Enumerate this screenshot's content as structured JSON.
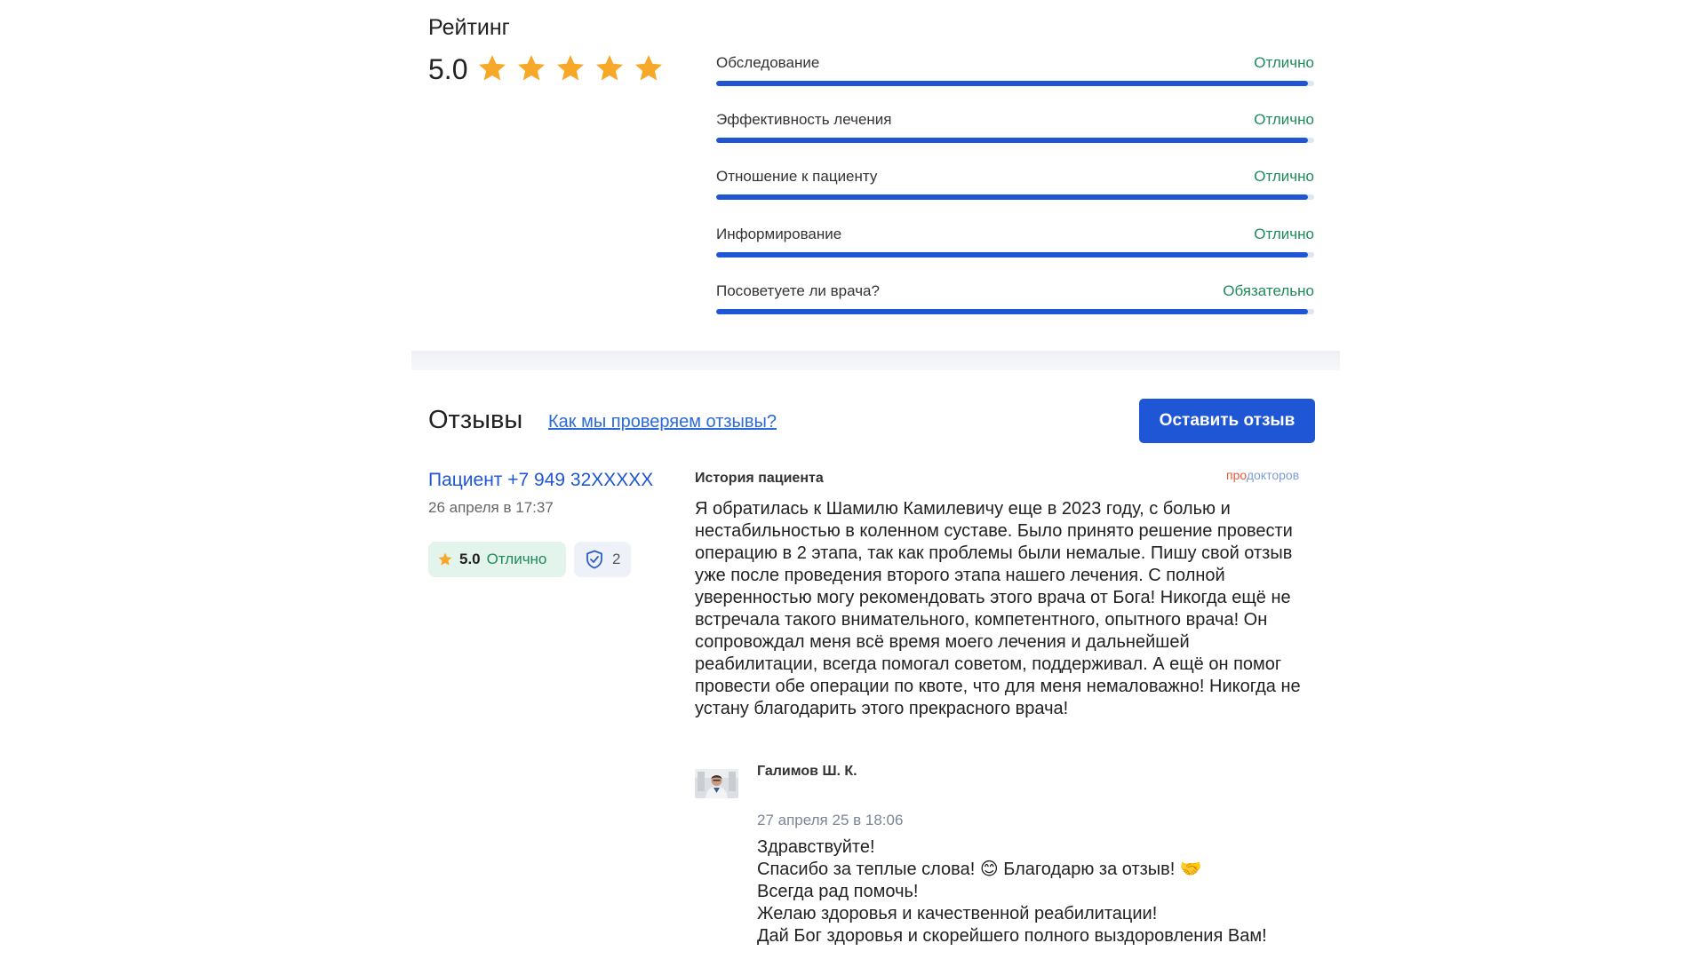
{
  "rating": {
    "title": "Рейтинг",
    "value": "5.0",
    "stars": 5,
    "star_color": "#f7a828",
    "criteria": [
      {
        "label": "Обследование",
        "value": "Отлично",
        "level": 0.99
      },
      {
        "label": "Эффективность лечения",
        "value": "Отлично",
        "level": 0.99
      },
      {
        "label": "Отношение к пациенту",
        "value": "Отлично",
        "level": 0.99
      },
      {
        "label": "Информирование",
        "value": "Отлично",
        "level": 0.99
      },
      {
        "label": "Посоветуете ли врача?",
        "value": "Обязательно",
        "level": 0.99
      }
    ]
  },
  "reviews": {
    "title": "Отзывы",
    "how_link": "Как мы проверяем отзывы?",
    "leave_button": "Оставить отзыв",
    "accent_color": "#1e56d6",
    "review": {
      "patient": "Пациент +7 949 32XXXXX",
      "date": "26 апреля в 17:37",
      "score": "5.0",
      "score_label": "Отлично",
      "verified_count": "2",
      "story_label": "История пациента",
      "source_part1": "про",
      "source_part2": "докторов",
      "text": "Я обратилась к Шамилю Камилевичу еще в 2023 году, с болью и нестабильностью в коленном суставе. Было принято решение провести операцию в 2 этапа, так как проблемы были немалые. Пишу свой отзыв уже после проведения второго этапа нашего лечения. С полной уверенностью могу рекомендовать этого врача от Бога! Никогда ещё не встречала такого внимательного, компетентного, опытного врача! Он сопровождал меня всё время моего лечения и дальнейшей реабилитации, всегда помогал советом, поддерживал. А ещё он помог провести обе операции по квоте, что для меня немаловажно! Никогда не устану благодарить этого прекрасного врача!",
      "reply": {
        "author": "Галимов Ш. К.",
        "date": "27 апреля 25 в 18:06",
        "text": "Здравствуйте!\nСпасибо за теплые слова! 😊 Благодарю за отзыв! 🤝\nВсегда рад помочь!\nЖелаю здоровья и качественной реабилитации!\nДай Бог здоровья и скорейшего полного выздоровления Вам!"
      }
    }
  }
}
